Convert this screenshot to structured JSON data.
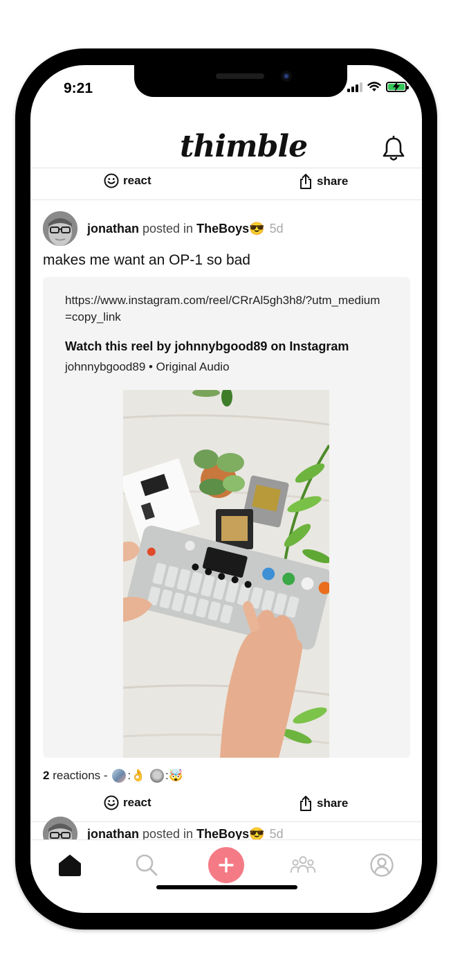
{
  "status_bar": {
    "time": "9:21"
  },
  "header": {
    "logo": "thimble",
    "bell_icon": "bell-icon"
  },
  "top_actions": {
    "react_label": "react",
    "share_label": "share"
  },
  "post": {
    "author": "jonathan",
    "posted_in": "posted in",
    "group": "TheBoys",
    "group_emoji": "😎",
    "age": "5d",
    "text": "makes me want an OP-1 so bad",
    "embed": {
      "url": "https://www.instagram.com/reel/CRrAl5gh3h8/?utm_medium=copy_link",
      "title": "Watch this reel by johnnybgood89 on Instagram",
      "subtitle": "johnnybgood89 • Original Audio"
    },
    "reactions": {
      "count": "2",
      "label": "reactions -",
      "items": [
        {
          "emoji": "👌"
        },
        {
          "emoji": "🤯"
        }
      ]
    },
    "actions": {
      "react_label": "react",
      "share_label": "share"
    }
  },
  "next_post": {
    "author": "jonathan",
    "posted_in": "posted in",
    "group": "TheBoys",
    "group_emoji": "😎",
    "age": "5d"
  },
  "tabbar": {
    "tabs": [
      {
        "icon": "home-icon",
        "active": true
      },
      {
        "icon": "search-icon",
        "active": false
      },
      {
        "icon": "plus-icon",
        "active": false
      },
      {
        "icon": "groups-icon",
        "active": false
      },
      {
        "icon": "profile-icon",
        "active": false
      }
    ],
    "accent": "#f47b86"
  }
}
